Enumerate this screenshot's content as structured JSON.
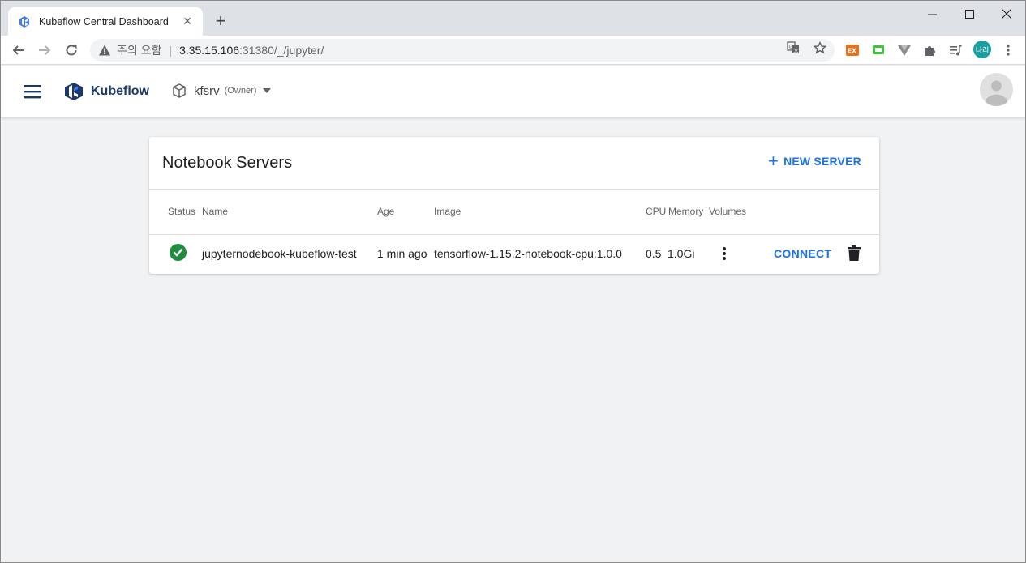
{
  "browser": {
    "tab_title": "Kubeflow Central Dashboard",
    "tab_close": "✕",
    "new_tab": "+",
    "security_label": "주의 요함",
    "url_separator": "|",
    "url_host": "3.35.15.106",
    "url_path": ":31380/_/jupyter/",
    "profile_initials": "나리",
    "profile_color": "#1a9fa0"
  },
  "header": {
    "app_name": "Kubeflow",
    "namespace": "kfsrv",
    "namespace_role": "(Owner)",
    "brand_color": "#1b3a6b"
  },
  "main": {
    "title": "Notebook Servers",
    "new_server_icon": "+",
    "new_server_label": "NEW SERVER",
    "columns": [
      "Status",
      "Name",
      "Age",
      "Image",
      "CPU",
      "Memory",
      "Volumes"
    ],
    "rows": [
      {
        "status": "ready",
        "name": "jupyternodebook-kubeflow-test",
        "age": "1 min ago",
        "image": "tensorflow-1.15.2-notebook-cpu:1.0.0",
        "cpu": "0.5",
        "memory": "1.0Gi",
        "connect_label": "CONNECT"
      }
    ],
    "accent_color": "#1a73e8",
    "status_color": "#1e8e3e"
  }
}
